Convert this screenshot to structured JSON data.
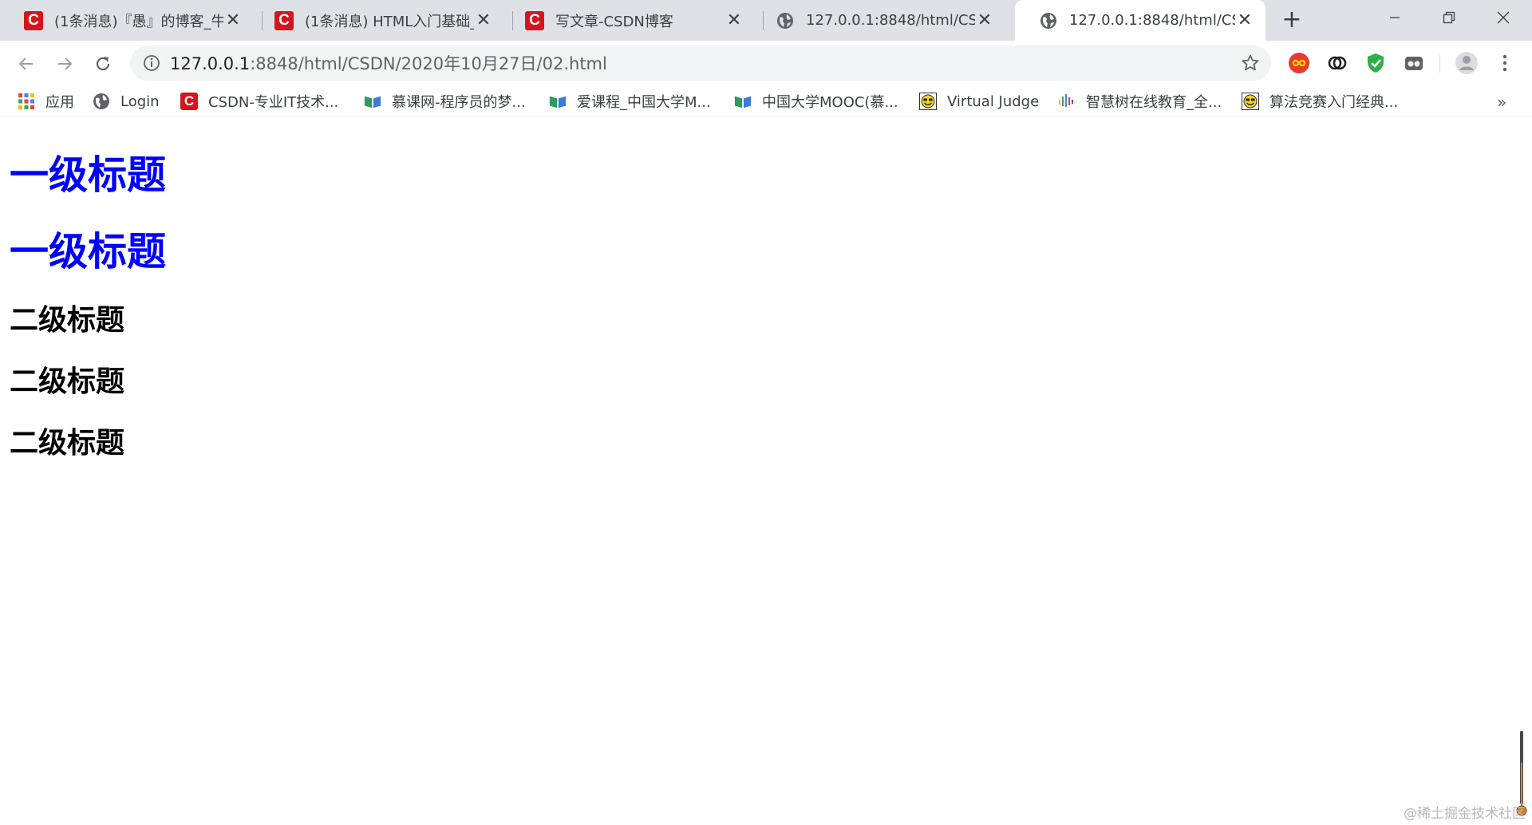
{
  "tabs": [
    {
      "title": "(1条消息)『愚』的博客_牛",
      "favicon": "csdn-icon",
      "active": false
    },
    {
      "title": "(1条消息) HTML入门基础_",
      "favicon": "csdn-icon",
      "active": false
    },
    {
      "title": "写文章-CSDN博客",
      "favicon": "csdn-icon",
      "active": false
    },
    {
      "title": "127.0.0.1:8848/html/CSDN",
      "favicon": "globe-icon",
      "active": false
    },
    {
      "title": "127.0.0.1:8848/html/CSDN",
      "favicon": "globe-icon",
      "active": true
    }
  ],
  "address_bar": {
    "host": "127.0.0.1",
    "path": ":8848/html/CSDN/2020年10月27日/02.html"
  },
  "bookmarks": [
    {
      "label": "应用",
      "icon": "apps-grid-icon"
    },
    {
      "label": "Login",
      "icon": "globe-icon"
    },
    {
      "label": "CSDN-专业IT技术...",
      "icon": "csdn-icon"
    },
    {
      "label": "慕课网-程序员的梦...",
      "icon": "book-icon"
    },
    {
      "label": "爱课程_中国大学M...",
      "icon": "book-icon"
    },
    {
      "label": "中国大学MOOC(慕...",
      "icon": "book-icon"
    },
    {
      "label": "Virtual Judge",
      "icon": "smiley-icon"
    },
    {
      "label": "智慧树在线教育_全...",
      "icon": "sound-bars-icon"
    },
    {
      "label": "算法竞赛入门经典...",
      "icon": "smiley-icon"
    }
  ],
  "page": {
    "h1": [
      "一级标题",
      "一级标题"
    ],
    "h2": [
      "二级标题",
      "二级标题",
      "二级标题"
    ]
  },
  "watermark": "@稀土掘金技术社区",
  "colors": {
    "heading1": "#0000ff",
    "heading2": "#000000",
    "csdn_red": "#d7141b",
    "tabstrip_bg": "#dee1e6"
  }
}
